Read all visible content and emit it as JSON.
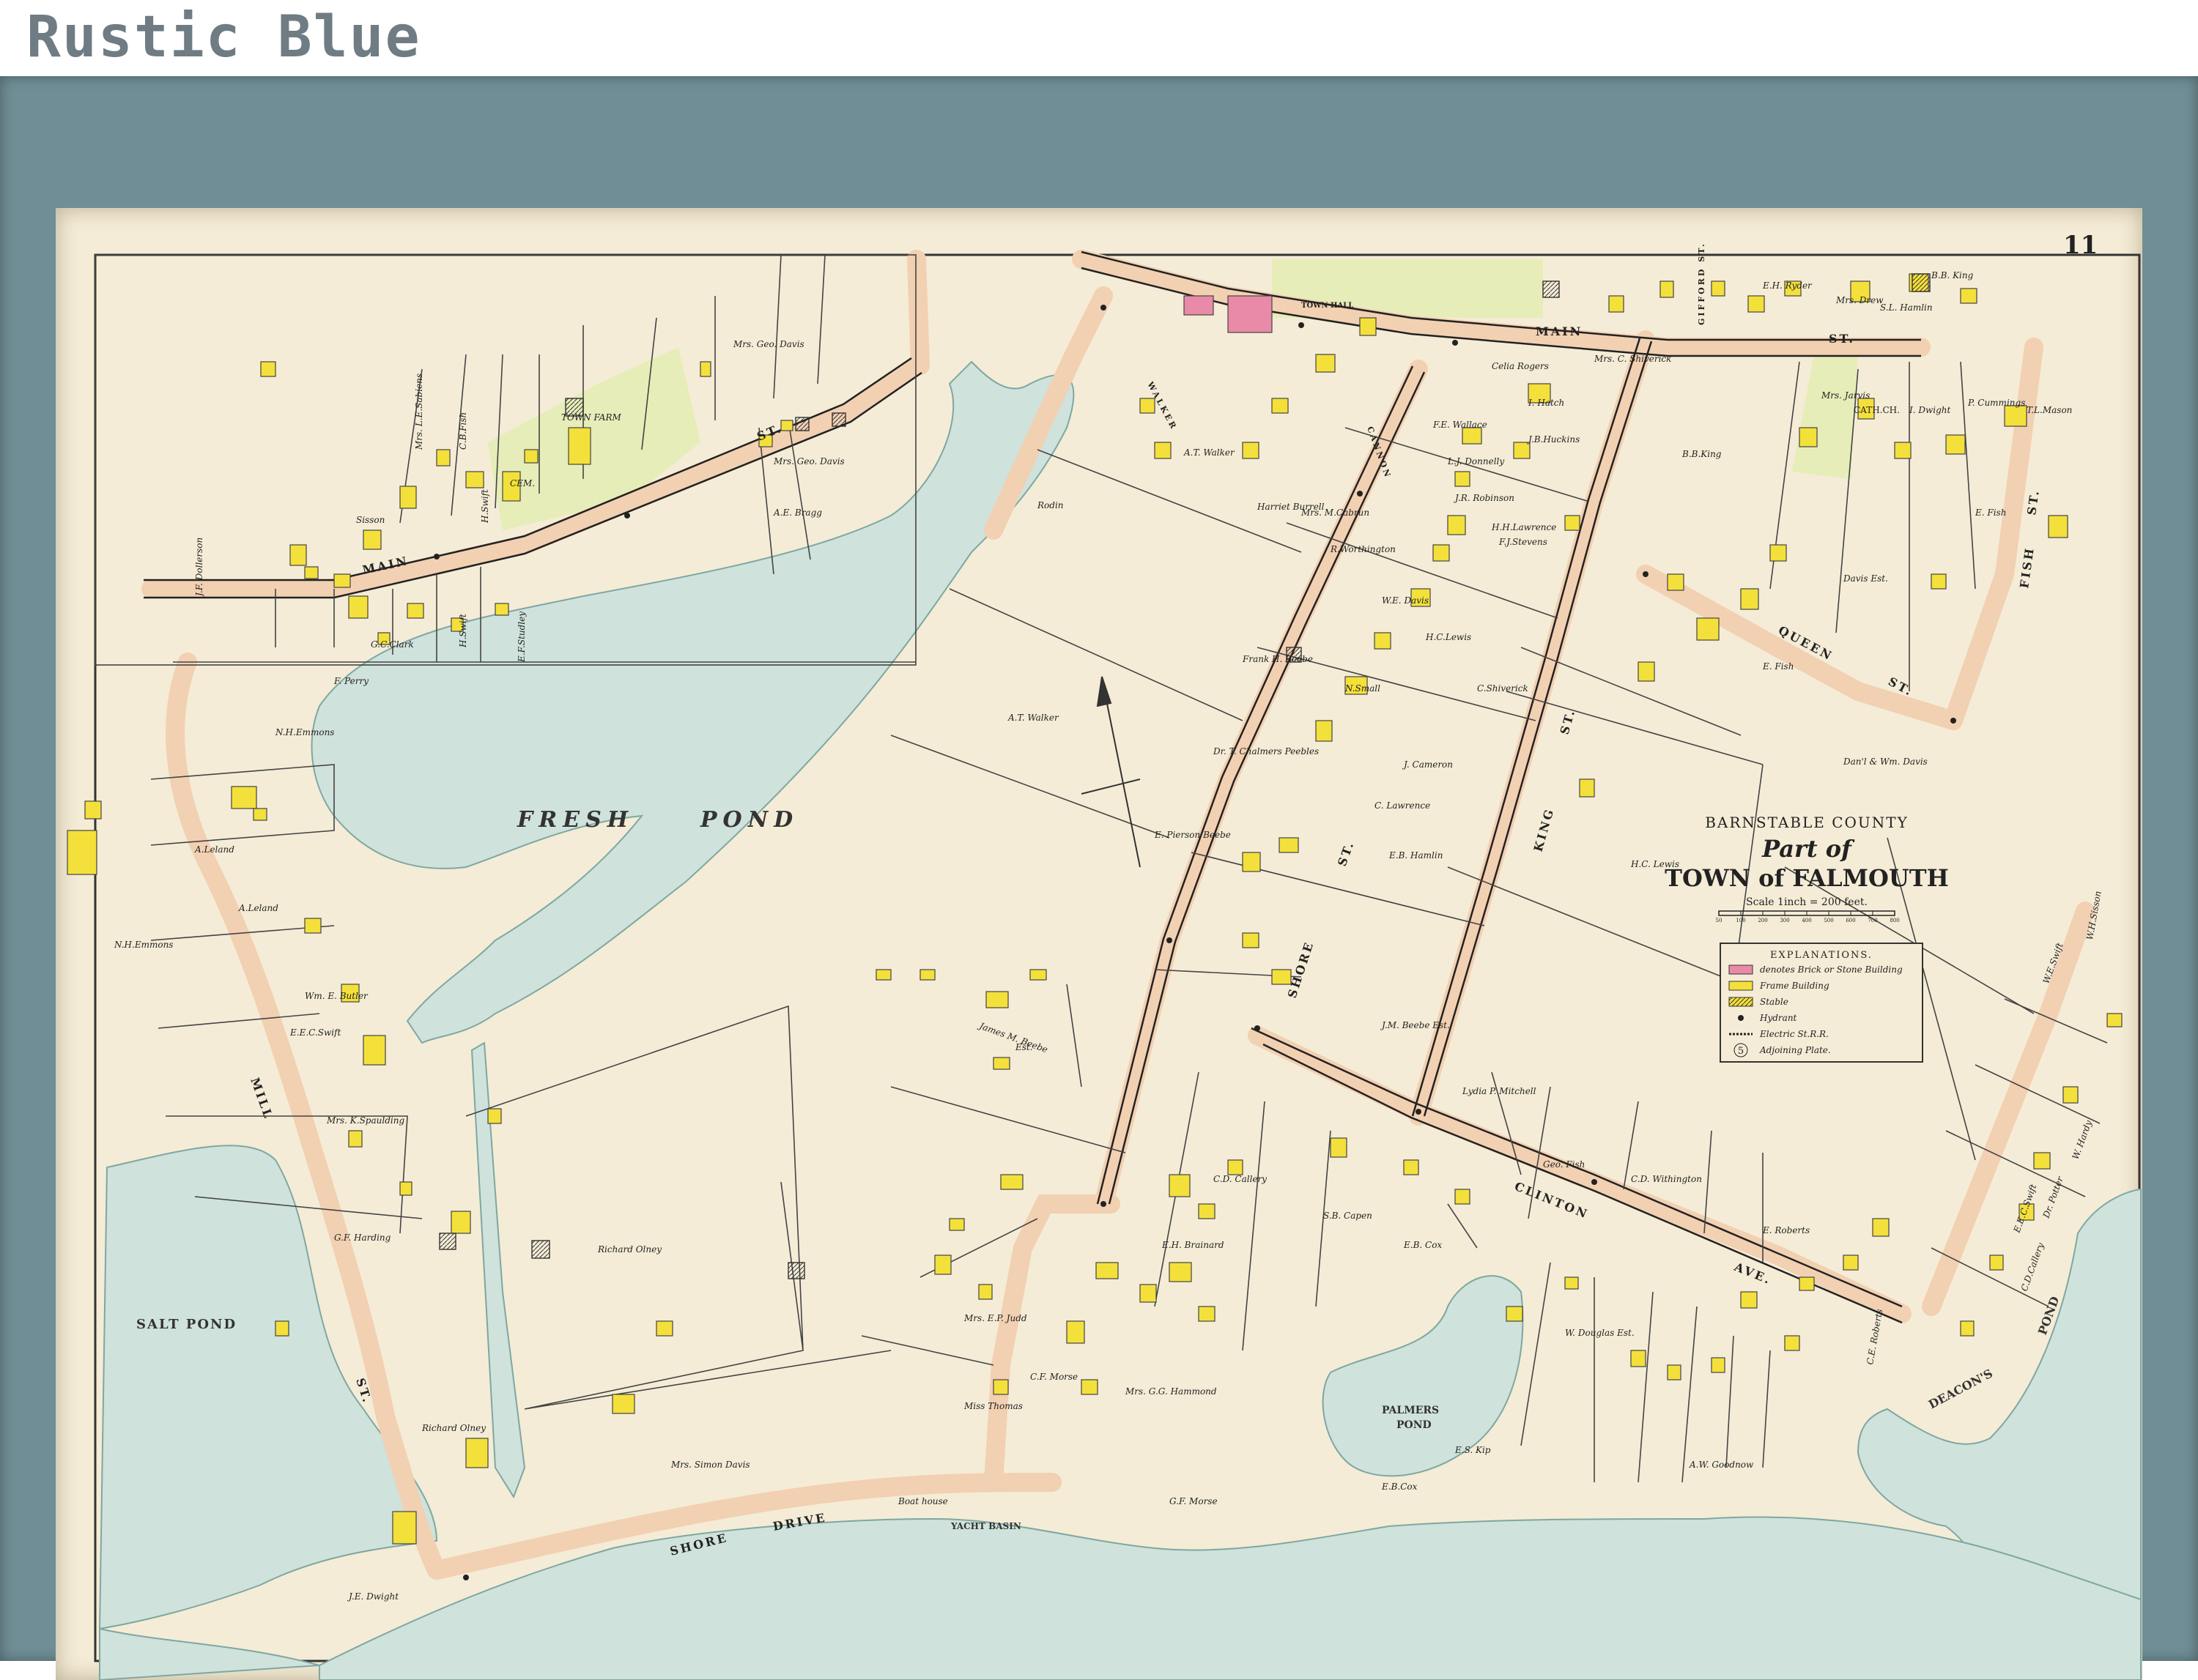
{
  "frame_label": "Rustic Blue",
  "plate_number": "11",
  "title": {
    "county": "BARNSTABLE COUNTY",
    "part_of": "Part of",
    "town": "TOWN of FALMOUTH",
    "scale": "Scale 1inch = 200 feet.",
    "scale_ticks": [
      "50",
      "100",
      "200",
      "300",
      "400",
      "500",
      "600",
      "700",
      "800"
    ]
  },
  "legend": {
    "heading": "EXPLANATIONS.",
    "items": [
      {
        "label": "denotes Brick or Stone Building",
        "symbol": "brick",
        "color": "#e88aa8"
      },
      {
        "label": "Frame Building",
        "symbol": "frame",
        "color": "#f4e03a"
      },
      {
        "label": "Stable",
        "symbol": "stable",
        "color": "#f4e03a"
      },
      {
        "label": "Hydrant",
        "symbol": "hydrant",
        "color": "#222222"
      },
      {
        "label": "Electric St.R.R.",
        "symbol": "railroad",
        "color": "#222222"
      },
      {
        "label": "Adjoining Plate.",
        "symbol": "plate",
        "badge": "5"
      }
    ]
  },
  "water_labels": {
    "fresh_pond_1": "FRESH",
    "fresh_pond_2": "POND",
    "salt_pond": "SALT POND",
    "palmers_pond_1": "PALMERS",
    "palmers_pond_2": "POND",
    "deacons_pond_1": "DEACON'S",
    "deacons_pond_2": "POND",
    "yacht_basin": "YACHT BASIN"
  },
  "street_labels": {
    "main_st_left": "MAIN",
    "main_st_left_st": "ST.",
    "main_st_top": "MAIN",
    "main_st_top_st": "ST.",
    "mill_st": "MILL",
    "mill_st_st": "ST.",
    "shore_drive": "SHORE",
    "shore_drive_2": "DRIVE",
    "shore_st": "SHORE",
    "shore_st_st": "ST.",
    "king_st": "KING",
    "king_st_st": "ST.",
    "queen_st": "QUEEN",
    "queen_st_st": "ST.",
    "clinton_ave": "CLINTON",
    "clinton_ave_2": "AVE.",
    "fish_st": "FISH",
    "fish_st_st": "ST.",
    "gifford_st": "GIFFORD ST.",
    "walker_st": "WALKER",
    "carlton_pl": "CANNON",
    "town_hall": "TOWN HALL",
    "cath_ch": "CATH.CH."
  },
  "owner_labels": [
    {
      "id": "dollerson",
      "text": "J.F. Dollerson"
    },
    {
      "id": "sisson",
      "text": "Sisson"
    },
    {
      "id": "sabiens",
      "text": "Mrs. L.E.Sabiens"
    },
    {
      "id": "cbfish",
      "text": "C.B.Fish"
    },
    {
      "id": "hswift1",
      "text": "H.Swift"
    },
    {
      "id": "townfarm",
      "text": "TOWN FARM"
    },
    {
      "id": "cem",
      "text": "CEM."
    },
    {
      "id": "geodavis1",
      "text": "Mrs. Geo. Davis"
    },
    {
      "id": "geodavis2",
      "text": "Mrs. Geo. Davis"
    },
    {
      "id": "bragg",
      "text": "A.E. Bragg"
    },
    {
      "id": "fperry",
      "text": "F. Perry"
    },
    {
      "id": "gcclark",
      "text": "G.C.Clark"
    },
    {
      "id": "hswift2",
      "text": "H.Swift"
    },
    {
      "id": "studley",
      "text": "E.F.Studley"
    },
    {
      "id": "nhemmons1",
      "text": "N.H.Emmons"
    },
    {
      "id": "nhemmons2",
      "text": "N.H.Emmons"
    },
    {
      "id": "aleland1",
      "text": "A.Leland"
    },
    {
      "id": "aleland2",
      "text": "A.Leland"
    },
    {
      "id": "butler",
      "text": "Wm. E. Butler"
    },
    {
      "id": "eecswift",
      "text": "E.E.C.Swift"
    },
    {
      "id": "spaulding",
      "text": "Mrs. K.Spaulding"
    },
    {
      "id": "harding",
      "text": "G.F. Harding"
    },
    {
      "id": "olney1",
      "text": "Richard Olney"
    },
    {
      "id": "olney2",
      "text": "Richard Olney"
    },
    {
      "id": "simondavis",
      "text": "Mrs. Simon Davis"
    },
    {
      "id": "dwight",
      "text": "J.E. Dwight"
    },
    {
      "id": "atwalker1",
      "text": "A.T. Walker"
    },
    {
      "id": "atwalker2",
      "text": "A.T. Walker"
    },
    {
      "id": "hburrell",
      "text": "Harriet Burrell"
    },
    {
      "id": "fhbeebe",
      "text": "Frank H. Beebe"
    },
    {
      "id": "epbeebe",
      "text": "E. Pierson Beebe"
    },
    {
      "id": "jmbeebe",
      "text": "James M. Beebe"
    },
    {
      "id": "jmbeebe_est",
      "text": "Est."
    },
    {
      "id": "peebles",
      "text": "Dr. T. Chalmers Peebles"
    },
    {
      "id": "cameron",
      "text": "J. Cameron"
    },
    {
      "id": "lawrence",
      "text": "C. Lawrence"
    },
    {
      "id": "ebhamlin",
      "text": "E.B. Hamlin"
    },
    {
      "id": "jmbeebeest",
      "text": "J.M. Beebe Est."
    },
    {
      "id": "cshiverick",
      "text": "C.Shiverick"
    },
    {
      "id": "hclewis1",
      "text": "H.C.Lewis"
    },
    {
      "id": "hclewis2",
      "text": "H.C. Lewis"
    },
    {
      "id": "efish1",
      "text": "E. Fish"
    },
    {
      "id": "efish2",
      "text": "E. Fish"
    },
    {
      "id": "davisest",
      "text": "Davis Est."
    },
    {
      "id": "danswm",
      "text": "Dan'l & Wm. Davis"
    },
    {
      "id": "mitchell",
      "text": "Lydia P. Mitchell"
    },
    {
      "id": "cdcallery",
      "text": "C.D. Callery"
    },
    {
      "id": "sbcapen",
      "text": "S.B. Capen"
    },
    {
      "id": "ehbrainard",
      "text": "E.H. Brainard"
    },
    {
      "id": "cfmorse",
      "text": "C.F. Morse"
    },
    {
      "id": "hammond",
      "text": "Mrs. G.G. Hammond"
    },
    {
      "id": "judd",
      "text": "Mrs. E.P. Judd"
    },
    {
      "id": "thomas",
      "text": "Miss Thomas"
    },
    {
      "id": "cdwithington",
      "text": "C.D. Withington"
    },
    {
      "id": "eroberts",
      "text": "E. Roberts"
    },
    {
      "id": "awgoodnow",
      "text": "A.W. Goodnow"
    },
    {
      "id": "celiarogers",
      "text": "Celia Rogers"
    },
    {
      "id": "jbhuckins",
      "text": "J.B.Huckins"
    },
    {
      "id": "jarvis",
      "text": "Mrs. Jarvis"
    },
    {
      "id": "dwight2",
      "text": "I. Dwight"
    },
    {
      "id": "pcummings",
      "text": "P. Cummings"
    },
    {
      "id": "tlmason",
      "text": "T.L.Mason"
    },
    {
      "id": "bbking1",
      "text": "B.B. King"
    },
    {
      "id": "bbking2",
      "text": "B.B.King"
    },
    {
      "id": "ehryder",
      "text": "E.H. Ryder"
    },
    {
      "id": "mrsdrew",
      "text": "Mrs. Drew"
    },
    {
      "id": "slhamlin",
      "text": "S.L. Hamlin"
    },
    {
      "id": "shiverick2",
      "text": "Mrs. C. Shiverick"
    },
    {
      "id": "ihatch",
      "text": "I. Hatch"
    },
    {
      "id": "fewallace",
      "text": "F.E. Wallace"
    },
    {
      "id": "donnelly",
      "text": "L.J. Donnelly"
    },
    {
      "id": "robinson",
      "text": "J.R. Robinson"
    },
    {
      "id": "hhlawrence",
      "text": "H.H.Lawrence"
    },
    {
      "id": "fjstevens",
      "text": "F.J.Stevens"
    },
    {
      "id": "cabrun",
      "text": "Mrs. M.Cabrun"
    },
    {
      "id": "worthington",
      "text": "R.Worthington"
    },
    {
      "id": "wedavis",
      "text": "W.E. Davis"
    },
    {
      "id": "nsmall",
      "text": "N.Small"
    },
    {
      "id": "ebcox",
      "text": "E.B. Cox"
    },
    {
      "id": "ebcox2",
      "text": "E.B.Cox"
    },
    {
      "id": "gfmorse",
      "text": "G.F. Morse"
    },
    {
      "id": "boathouse",
      "text": "Boat house"
    },
    {
      "id": "wswift",
      "text": "W.E.Swift"
    },
    {
      "id": "ecswift2",
      "text": "E.E.C.Swift"
    },
    {
      "id": "wmhardy",
      "text": "W. Hardy"
    },
    {
      "id": "drpotter",
      "text": "Dr. Potter"
    },
    {
      "id": "cdcallery2",
      "text": "C.D.Callery"
    },
    {
      "id": "wmsisson",
      "text": "W.H.Sisson"
    },
    {
      "id": "doutgas",
      "text": "W. Douglas Est."
    },
    {
      "id": "geofish",
      "text": "Geo. Fish"
    },
    {
      "id": "rodin",
      "text": "Rodin"
    },
    {
      "id": "ceroberts",
      "text": "C.E. Roberts"
    },
    {
      "id": "elkip",
      "text": "E.S. Kip"
    }
  ]
}
